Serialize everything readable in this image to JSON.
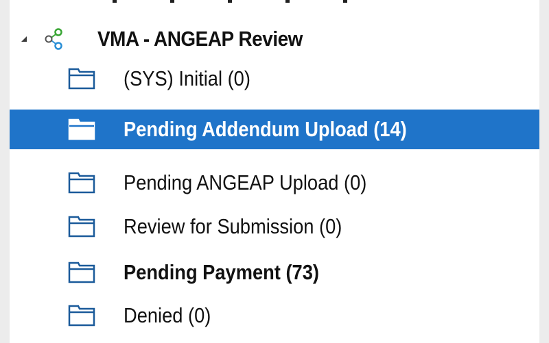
{
  "tree": {
    "root": {
      "label": "VMA - ANGEAP Review",
      "icon": "workflow-icon",
      "expanded": true
    },
    "items": [
      {
        "label": "(SYS) Initial (0)",
        "icon": "folder-icon",
        "selected": false,
        "bold": false
      },
      {
        "label": "Pending Addendum Upload (14)",
        "icon": "folder-icon",
        "selected": true,
        "bold": true
      },
      {
        "label": "Pending ANGEAP Upload (0)",
        "icon": "folder-icon",
        "selected": false,
        "bold": false
      },
      {
        "label": "Review for Submission (0)",
        "icon": "folder-icon",
        "selected": false,
        "bold": false
      },
      {
        "label": "Pending Payment (73)",
        "icon": "folder-icon",
        "selected": false,
        "bold": true
      },
      {
        "label": "Denied (0)",
        "icon": "folder-icon",
        "selected": false,
        "bold": false
      }
    ]
  },
  "colors": {
    "selection": "#1f74c9",
    "workflow_green": "#3aa635",
    "workflow_blue": "#2a8fd6",
    "text": "#111111"
  }
}
